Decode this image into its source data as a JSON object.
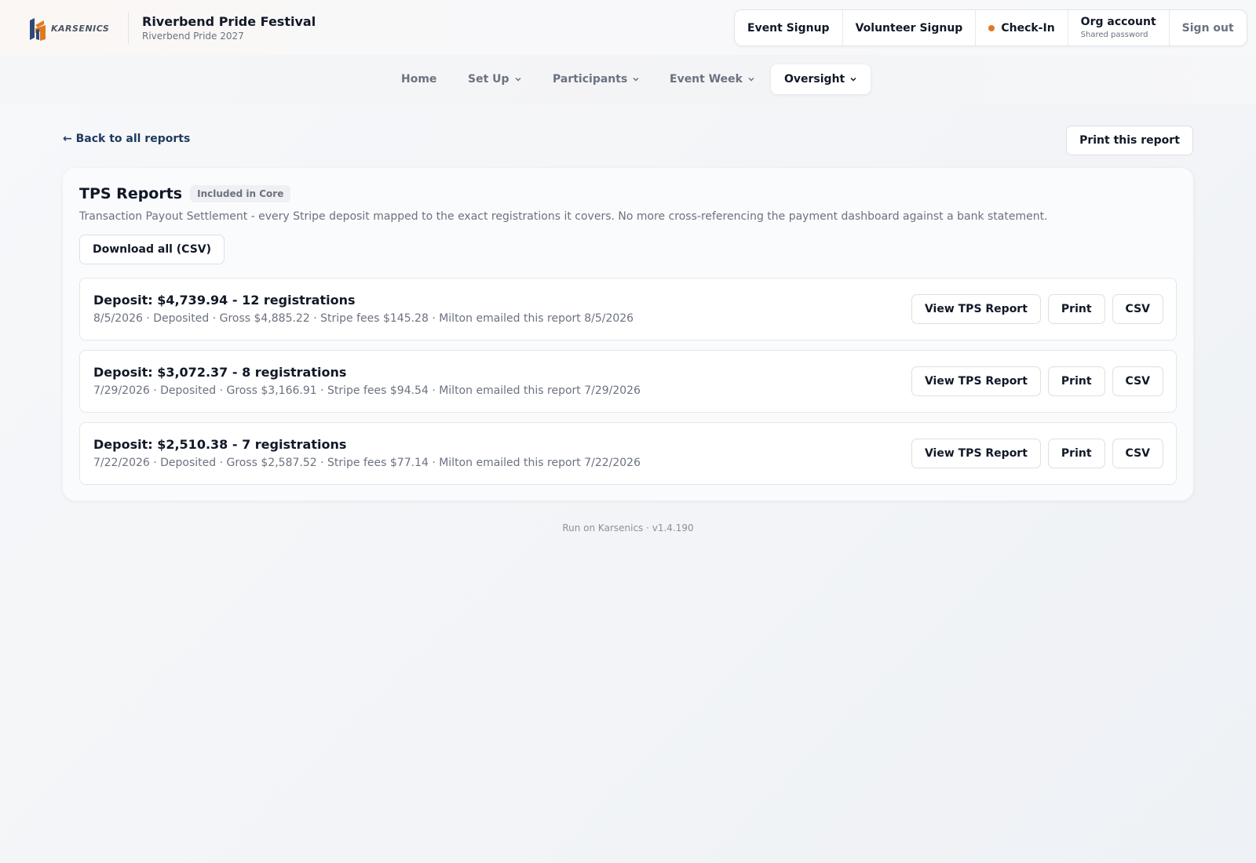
{
  "brand": {
    "logo_text": "KARSENICS"
  },
  "event": {
    "title": "Riverbend Pride Festival",
    "subtitle": "Riverbend Pride 2027"
  },
  "actions": {
    "event_signup": "Event Signup",
    "volunteer_signup": "Volunteer Signup",
    "check_in": "Check-In",
    "org_account": "Org account",
    "org_account_sub": "Shared password",
    "sign_out": "Sign out"
  },
  "nav": {
    "items": [
      {
        "label": "Home"
      },
      {
        "label": "Set Up"
      },
      {
        "label": "Participants"
      },
      {
        "label": "Event Week"
      },
      {
        "label": "Oversight"
      }
    ],
    "active": "Oversight"
  },
  "page": {
    "back_label": "← Back to all reports",
    "print_label": "Print this report"
  },
  "report": {
    "title": "TPS Reports",
    "badge": "Included in Core",
    "description": "Transaction Payout Settlement - every Stripe deposit mapped to the exact registrations it covers. No more cross-referencing the payment dashboard against a bank statement.",
    "download_all": "Download all (CSV)",
    "deposits": [
      {
        "title": "Deposit: $4,739.94 - 12 registrations",
        "meta": "8/5/2026 · Deposited · Gross $4,885.22 · Stripe fees $145.28 · Milton emailed this report 8/5/2026",
        "view": "View TPS Report",
        "print": "Print",
        "csv": "CSV"
      },
      {
        "title": "Deposit: $3,072.37 - 8 registrations",
        "meta": "7/29/2026 · Deposited · Gross $3,166.91 · Stripe fees $94.54 · Milton emailed this report 7/29/2026",
        "view": "View TPS Report",
        "print": "Print",
        "csv": "CSV"
      },
      {
        "title": "Deposit: $2,510.38 - 7 registrations",
        "meta": "7/22/2026 · Deposited · Gross $2,587.52 · Stripe fees $77.14 · Milton emailed this report 7/22/2026",
        "view": "View TPS Report",
        "print": "Print",
        "csv": "CSV"
      }
    ]
  },
  "footer": {
    "text": "Run on Karsenics · v1.4.190"
  },
  "colors": {
    "accent": "#e07a22",
    "link": "#1e3a5f",
    "logo_blue": "#2f4a7a",
    "logo_orange": "#e07a22"
  }
}
